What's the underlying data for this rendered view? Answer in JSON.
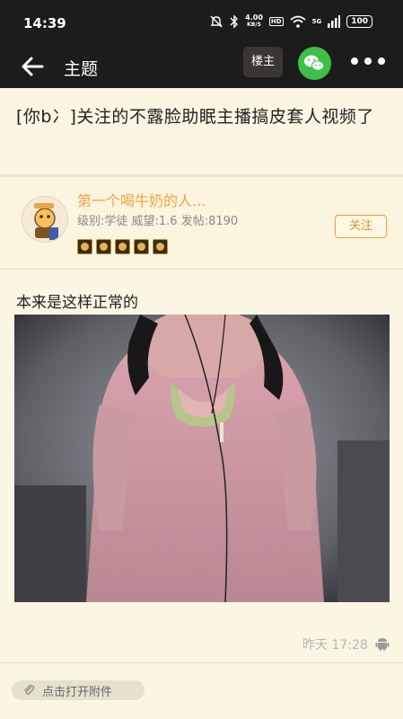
{
  "status_bar": {
    "time": "14:39",
    "net_speed_value": "4.00",
    "net_speed_unit": "KB/S",
    "hd": "HD",
    "signal": "5G",
    "battery": "100"
  },
  "nav": {
    "title": "主题",
    "op_button": "楼主",
    "wechat_icon": "wechat-icon",
    "more_icon": "more-dots-icon"
  },
  "post": {
    "title": "[你b冫]关注的不露脸助眠主播搞皮套人视频了",
    "content_text": "本来是这样正常的",
    "time": "昨天 17:28",
    "device_icon": "android-icon"
  },
  "author": {
    "name": "第一个喝牛奶的人...",
    "info": "级别:学徒 威望:1.6 发帖:8190",
    "follow_label": "关注",
    "medal_count": 5
  },
  "footer": {
    "attachment_label": "点击打开附件",
    "attachment_icon": "paperclip-icon"
  },
  "colors": {
    "background": "#fbf6e3",
    "header": "#1c1c1c",
    "accent": "#f0a545",
    "wechat": "#3fbf45"
  }
}
